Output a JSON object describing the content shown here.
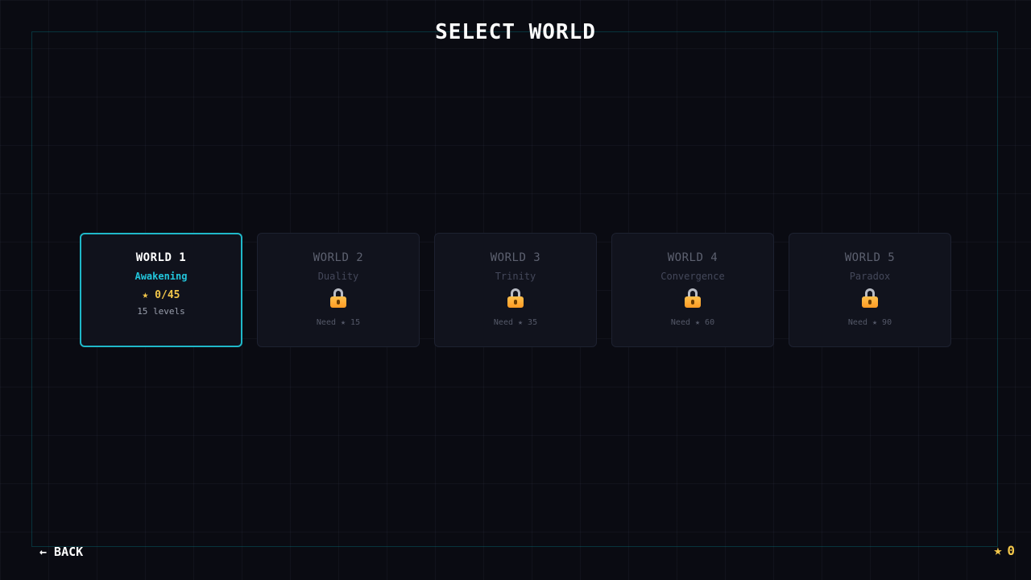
{
  "screen": {
    "title": "SELECT WORLD"
  },
  "worlds": [
    {
      "name": "WORLD 1",
      "subtitle": "Awakening",
      "stars": "★ 0/45",
      "levels": "15 levels",
      "locked": false
    },
    {
      "name": "WORLD 2",
      "subtitle": "Duality",
      "requirement": "Need ★ 15",
      "locked": true
    },
    {
      "name": "WORLD 3",
      "subtitle": "Trinity",
      "requirement": "Need ★ 35",
      "locked": true
    },
    {
      "name": "WORLD 4",
      "subtitle": "Convergence",
      "requirement": "Need ★ 60",
      "locked": true
    },
    {
      "name": "WORLD 5",
      "subtitle": "Paradox",
      "requirement": "Need ★ 90",
      "locked": true
    }
  ],
  "footer": {
    "back_label": "← BACK",
    "star_icon": "★",
    "total_stars": "0"
  },
  "colors": {
    "accent": "#1fb8c9",
    "subtitle": "#22c6dc",
    "star": "#f2c64a",
    "background": "#0a0b12"
  },
  "icons": {
    "lock": "lock-icon",
    "star": "star-icon",
    "back": "arrow-left-icon"
  }
}
